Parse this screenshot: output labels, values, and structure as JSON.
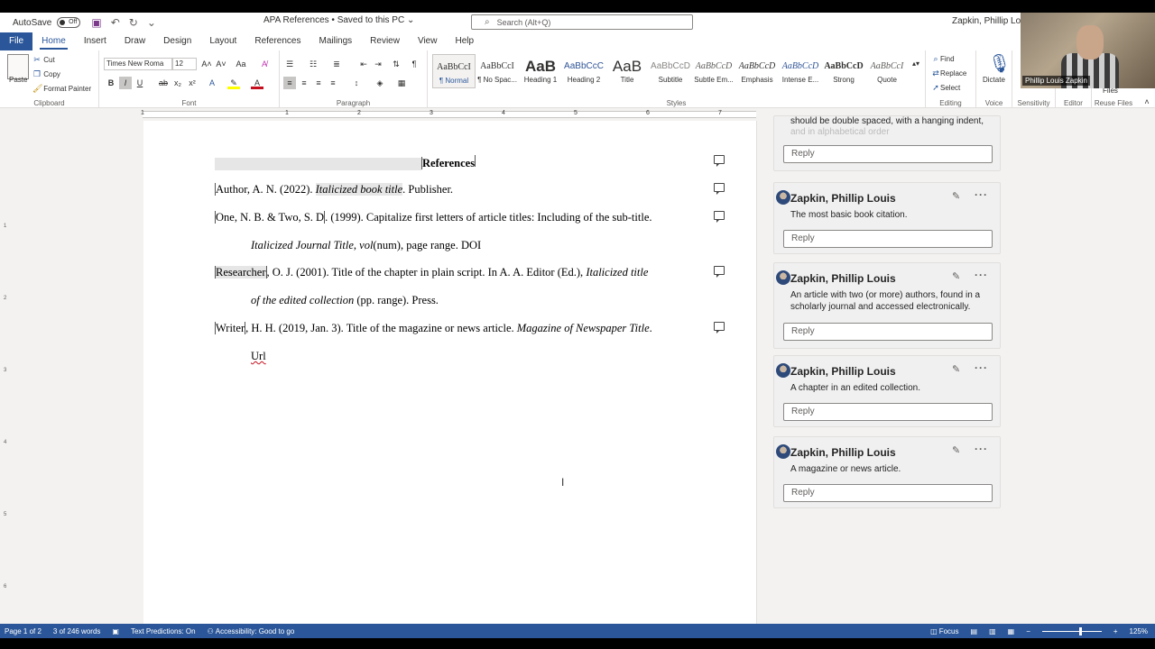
{
  "titlebar": {
    "autosave_label": "AutoSave",
    "autosave_state": "Off",
    "doc_title": "APA References • Saved to this PC ⌄",
    "search_placeholder": "Search (Alt+Q)",
    "user_name": "Zapkin, Phillip Louis"
  },
  "tabs": [
    "File",
    "Home",
    "Insert",
    "Draw",
    "Design",
    "Layout",
    "References",
    "Mailings",
    "Review",
    "View",
    "Help"
  ],
  "active_tab": "Home",
  "ribbon": {
    "clipboard": {
      "paste": "Paste",
      "cut": "Cut",
      "copy": "Copy",
      "format_painter": "Format Painter",
      "label": "Clipboard"
    },
    "font": {
      "name": "Times New Roma",
      "size": "12",
      "label": "Font"
    },
    "paragraph": {
      "label": "Paragraph"
    },
    "styles": {
      "label": "Styles",
      "items": [
        {
          "sample": "AaBbCcI",
          "name": "¶ Normal"
        },
        {
          "sample": "AaBbCcI",
          "name": "¶ No Spac..."
        },
        {
          "sample": "AaB",
          "name": "Heading 1"
        },
        {
          "sample": "AaBbCcC",
          "name": "Heading 2"
        },
        {
          "sample": "AaB",
          "name": "Title"
        },
        {
          "sample": "AaBbCcD",
          "name": "Subtitle"
        },
        {
          "sample": "AaBbCcD",
          "name": "Subtle Em..."
        },
        {
          "sample": "AaBbCcD",
          "name": "Emphasis"
        },
        {
          "sample": "AaBbCcD",
          "name": "Intense E..."
        },
        {
          "sample": "AaBbCcD",
          "name": "Strong"
        },
        {
          "sample": "AaBbCcI",
          "name": "Quote"
        }
      ]
    },
    "editing": {
      "find": "Find",
      "replace": "Replace",
      "select": "Select",
      "label": "Editing"
    },
    "voice": {
      "dictate": "Dictate",
      "label": "Voice"
    },
    "sensitivity": {
      "label": "Sensitivity"
    },
    "editor": {
      "label": "Editor"
    },
    "reuse": {
      "label": "Reuse Files",
      "files": "Files"
    }
  },
  "webcam": {
    "name": "Phillip Louis Zapkin"
  },
  "ruler": {
    "numbers": [
      "1",
      "1",
      "2",
      "3",
      "4",
      "5",
      "6",
      "7"
    ]
  },
  "vruler": {
    "numbers": [
      "1",
      "2",
      "3",
      "4",
      "5",
      "6"
    ]
  },
  "document": {
    "heading": "References",
    "refs": {
      "r1_a": "Author",
      "r1_b": ", A. N. (2022). ",
      "r1_c": "Italicized book title",
      "r1_d": ". Publisher.",
      "r2_a": "One, N. B. & Two, S. D",
      "r2_b": ". (1999). Capitalize first letters of article titles: Including of the sub-title.",
      "r2_c": "Italicized Journal Title",
      "r2_d": ", ",
      "r2_e": "vol",
      "r2_f": "(num), page range. DOI",
      "r3_a": "Researcher",
      "r3_b": ", O. J. (2001). Title of the chapter in plain script. In A. A. Editor (Ed.), ",
      "r3_c": "Italicized title",
      "r3_d": "of the edited collection",
      "r3_e": " (pp. range). Press.",
      "r4_a": "Writer",
      "r4_b": ", H. H. (2019, Jan. 3). Title of the magazine or news article. ",
      "r4_c": "Magazine of Newspaper Title",
      "r4_d": ".",
      "r4_e": "Url"
    }
  },
  "comments": {
    "partial_text": "should be double spaced, with a hanging indent,",
    "partial_text2": "and in alphabetical order",
    "reply_label": "Reply",
    "items": [
      {
        "author": "Zapkin, Phillip Louis",
        "body": "The most basic book citation."
      },
      {
        "author": "Zapkin, Phillip Louis",
        "body": "An article with two (or more) authors, found in a scholarly journal and accessed electronically."
      },
      {
        "author": "Zapkin, Phillip Louis",
        "body": "A chapter in an edited collection."
      },
      {
        "author": "Zapkin, Phillip Louis",
        "body": "A magazine or news article."
      }
    ]
  },
  "status": {
    "page": "Page 1 of 2",
    "words": "3 of 246 words",
    "predictions": "Text Predictions: On",
    "accessibility": "Accessibility: Good to go",
    "focus": "Focus",
    "zoom": "125%"
  }
}
